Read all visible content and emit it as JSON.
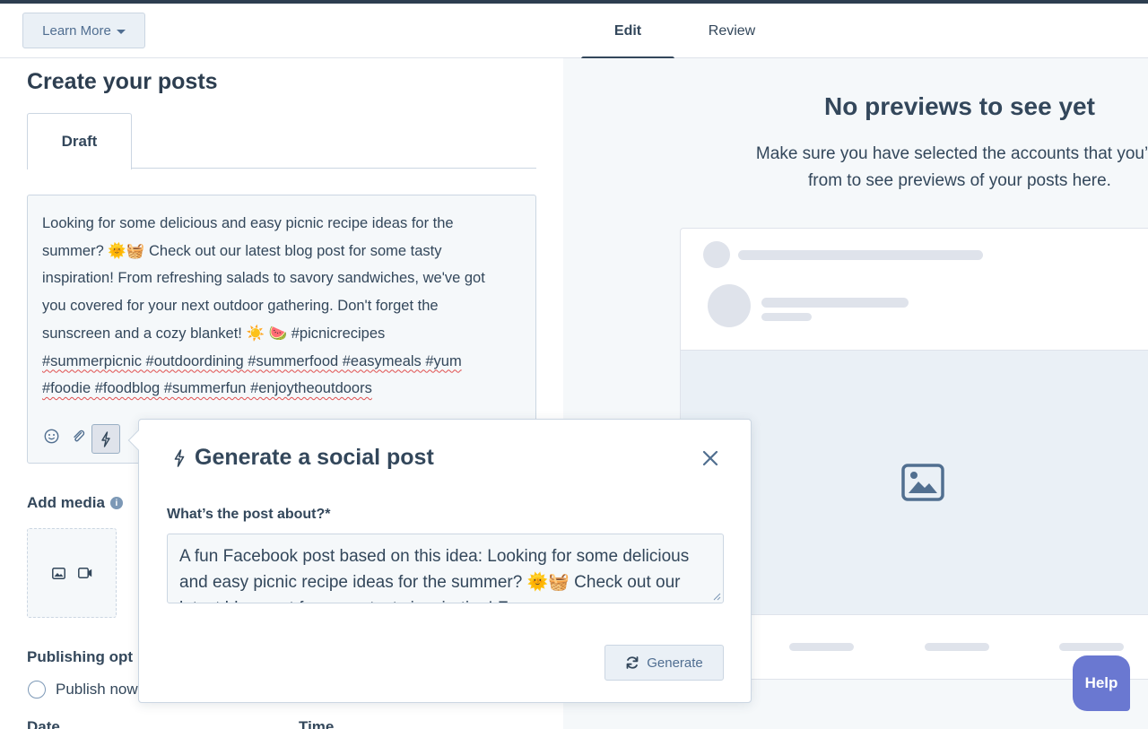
{
  "header": {
    "learn_more": "Learn More",
    "tabs": [
      {
        "label": "Edit",
        "active": true
      },
      {
        "label": "Review",
        "active": false
      }
    ]
  },
  "left": {
    "title": "Create your posts",
    "draft_tab": "Draft",
    "editor": {
      "lines": [
        "Looking for some delicious and easy picnic recipe ideas for the",
        "summer? 🌞🧺 Check out our latest blog post for some tasty",
        "inspiration! From refreshing salads to savory sandwiches, we've got",
        "you covered for your next outdoor gathering. Don't forget the",
        "sunscreen and a cozy blanket! ☀️ 🍉 #picnicrecipes",
        "#summerpicnic #outdoordining #summerfood #easymeals #yum",
        "#foodie #foodblog #summerfun #enjoytheoutdoors"
      ]
    },
    "add_media": "Add media",
    "publishing_options": "Publishing opt",
    "publish_now": "Publish now",
    "date_label": "Date",
    "time_label": "Time"
  },
  "preview": {
    "title": "No previews to see yet",
    "subtitle_line1": "Make sure you have selected the accounts that you’re",
    "subtitle_line2": "from to see previews of your posts here."
  },
  "popup": {
    "title": "Generate a social post",
    "field_label": "What’s the post about?*",
    "textarea_value": "A fun Facebook post based on this idea: Looking for some delicious and easy picnic recipe ideas for the summer? 🌞🧺 Check out our latest blog post for some tasty inspiration! From",
    "generate_label": "Generate"
  },
  "help": {
    "label": "Help"
  },
  "colors": {
    "text": "#33475b",
    "border": "#cbd6e2",
    "panel_bg": "#f5f8fa",
    "help_bg": "#6a78d1"
  }
}
